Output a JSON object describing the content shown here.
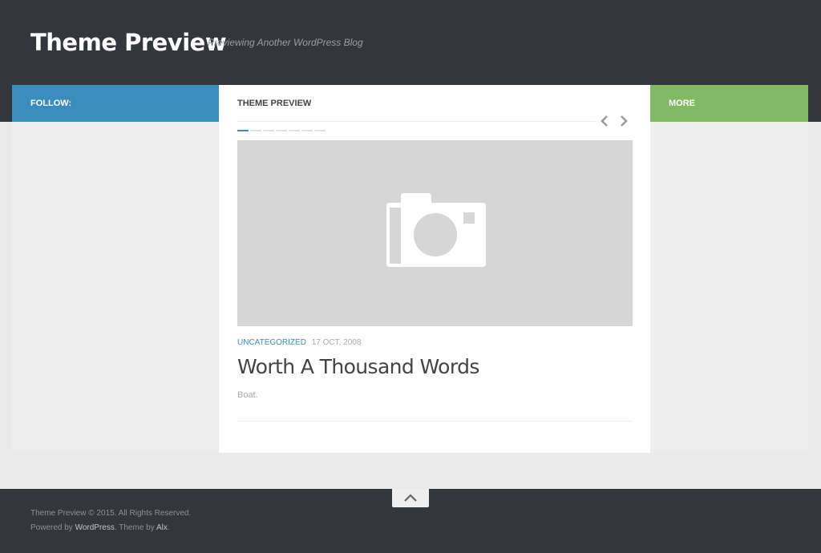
{
  "header": {
    "site_title": "Theme Preview",
    "site_description": "Previewing Another WordPress Blog"
  },
  "sidebar_left": {
    "heading": "Follow:"
  },
  "sidebar_right": {
    "heading": "More"
  },
  "content": {
    "heading": "Theme Preview",
    "slider": {
      "prev_icon": "chevron-left-icon",
      "next_icon": "chevron-right-icon",
      "slide_count": 7,
      "active_index": 0
    },
    "post": {
      "thumbnail_icon": "camera-icon",
      "category": "Uncategorized",
      "date": "17 Oct, 2008",
      "title": "Worth A Thousand Words",
      "excerpt": "Boat."
    }
  },
  "footer": {
    "back_to_top_icon": "chevron-up-icon",
    "copyright": "Theme Preview © 2015. All Rights Reserved.",
    "powered_prefix": "Powered by ",
    "powered_link": "WordPress",
    "theme_prefix": ". Theme by ",
    "theme_link": "Alx",
    "theme_suffix": "."
  },
  "colors": {
    "header_bg": "#33363b",
    "follow_bar": "#3b8dbd",
    "more_bar": "#82b965",
    "accent": "#3b8dbd"
  }
}
